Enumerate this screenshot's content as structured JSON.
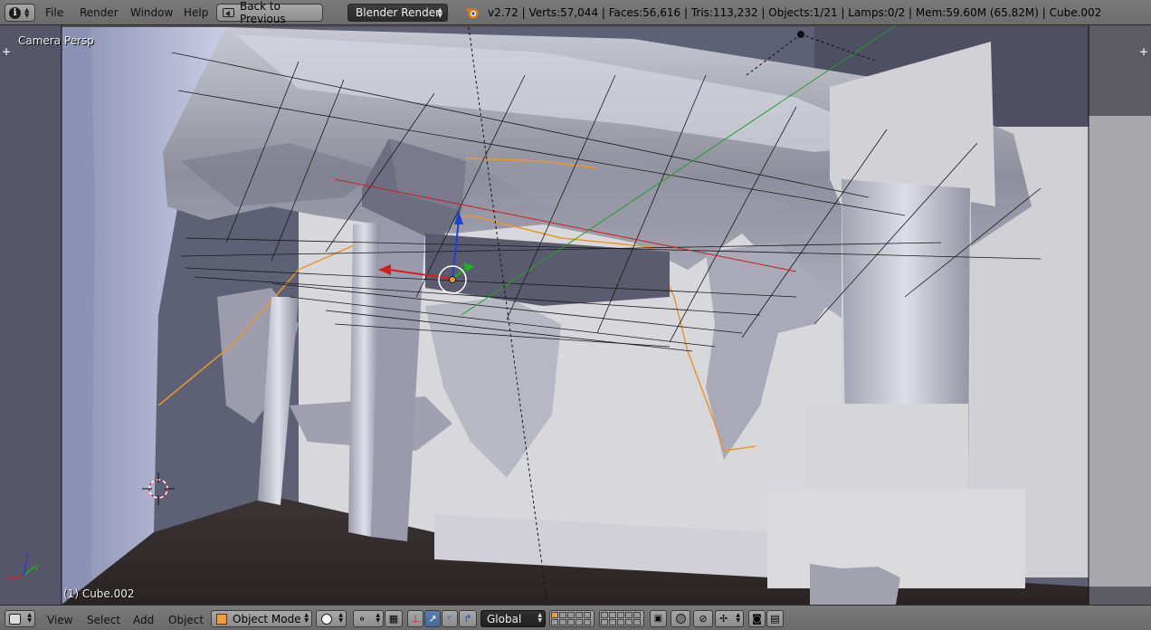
{
  "topbar": {
    "menus": [
      "File",
      "Render",
      "Window",
      "Help"
    ],
    "back_label": "Back to Previous",
    "render_engine": "Blender Render",
    "stats": "v2.72 | Verts:57,044 | Faces:56,616 | Tris:113,232 | Objects:1/21 | Lamps:0/2 | Mem:59.60M (65.82M) | Cube.002"
  },
  "viewport": {
    "view_label": "Camera Persp",
    "object_label": "(1) Cube.002"
  },
  "bottombar": {
    "menus": [
      "View",
      "Select",
      "Add",
      "Object"
    ],
    "mode": "Object Mode",
    "orientation": "Global"
  },
  "colors": {
    "header": "#727272",
    "selection_outline": "#e8962e",
    "axis_x": "#d02020",
    "axis_y": "#20b020",
    "axis_z": "#2040d0"
  }
}
